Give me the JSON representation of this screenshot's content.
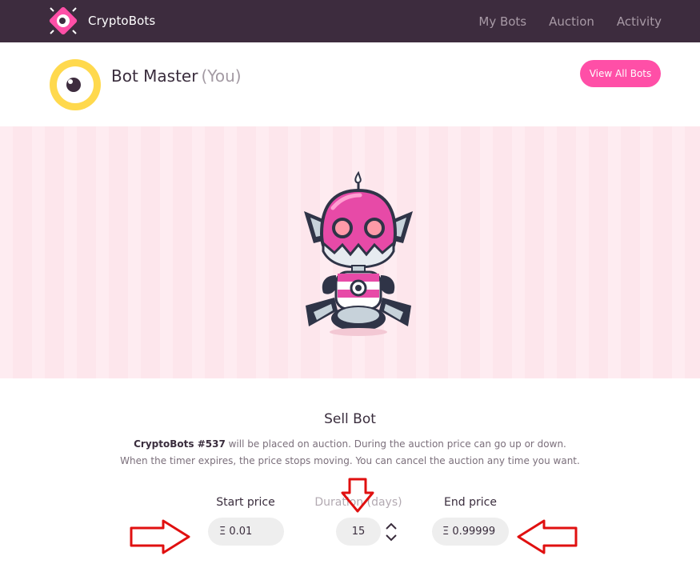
{
  "app": {
    "brand_name": "CryptoBots",
    "nav": [
      "My Bots",
      "Auction",
      "Activity"
    ]
  },
  "profile": {
    "name": "Bot Master",
    "you_tag": "(You)",
    "view_all_label": "View All Bots"
  },
  "sell": {
    "title": "Sell Bot",
    "bot_name": "CryptoBots #537",
    "desc_line1": " will be placed on auction. During the auction price can go up or down.",
    "desc_line2": "When the timer expires, the price stops moving. You can cancel the auction any time you want.",
    "start_label": "Start price",
    "duration_label": "Duration (days)",
    "end_label": "End price",
    "start_value": "Ξ 0.01",
    "duration_value": "15",
    "end_value": "Ξ 0.99999"
  },
  "colors": {
    "topbar": "#3d2c3e",
    "accent_pink": "#ff4fa7",
    "showcase_bg": "#fde6ec",
    "avatar_yellow": "#ffd94d",
    "annotation_red": "#e01010"
  },
  "icons": {
    "logo": "cryptobots-logo-icon",
    "avatar": "eye-avatar-icon",
    "stepper": "chevron-up-down-icon",
    "annotation": "red-arrow-icon"
  }
}
